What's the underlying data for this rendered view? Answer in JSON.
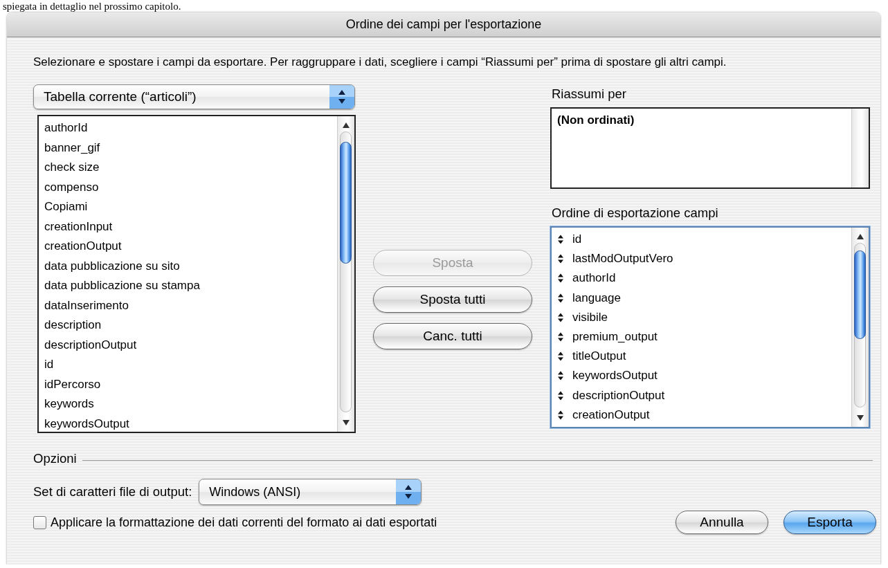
{
  "page_text": "spiegata in dettaglio nel prossimo capitolo.",
  "window": {
    "title": "Ordine dei campi per l'esportazione"
  },
  "instructions": "Selezionare e spostare i campi da esportare.  Per raggruppare i dati, scegliere i campi “Riassumi per” prima di spostare gli altri campi.",
  "table_popup": {
    "value": "Tabella corrente (“articoli”)"
  },
  "fields": [
    "authorId",
    "banner_gif",
    "check size",
    "compenso",
    "Copiami",
    "creationInput",
    "creationOutput",
    "data pubblicazione su sito",
    "data pubblicazione su stampa",
    "dataInserimento",
    "description",
    "descriptionOutput",
    "id",
    "idPercorso",
    "keywords",
    "keywordsOutput"
  ],
  "move_buttons": [
    {
      "label": "Sposta",
      "disabled": true
    },
    {
      "label": "Sposta tutti",
      "disabled": false
    },
    {
      "label": "Canc. tutti",
      "disabled": false
    }
  ],
  "summarize_by": {
    "label": "Riassumi per",
    "items": [
      "(Non ordinati)"
    ]
  },
  "export_order": {
    "label": "Ordine di esportazione campi",
    "items": [
      "id",
      "lastModOutputVero",
      "authorId",
      "language",
      "visibile",
      "premium_output",
      "titleOutput",
      "keywordsOutput",
      "descriptionOutput",
      "creationOutput"
    ]
  },
  "options": {
    "label": "Opzioni",
    "charset_label": "Set di caratteri file di output:",
    "charset_value": "Windows (ANSI)",
    "format_checkbox": {
      "label": "Applicare la formattazione dei dati correnti del formato ai dati esportati",
      "checked": false
    }
  },
  "dialog_buttons": [
    {
      "label": "Annulla",
      "default": false
    },
    {
      "label": "Esporta",
      "default": true
    }
  ]
}
